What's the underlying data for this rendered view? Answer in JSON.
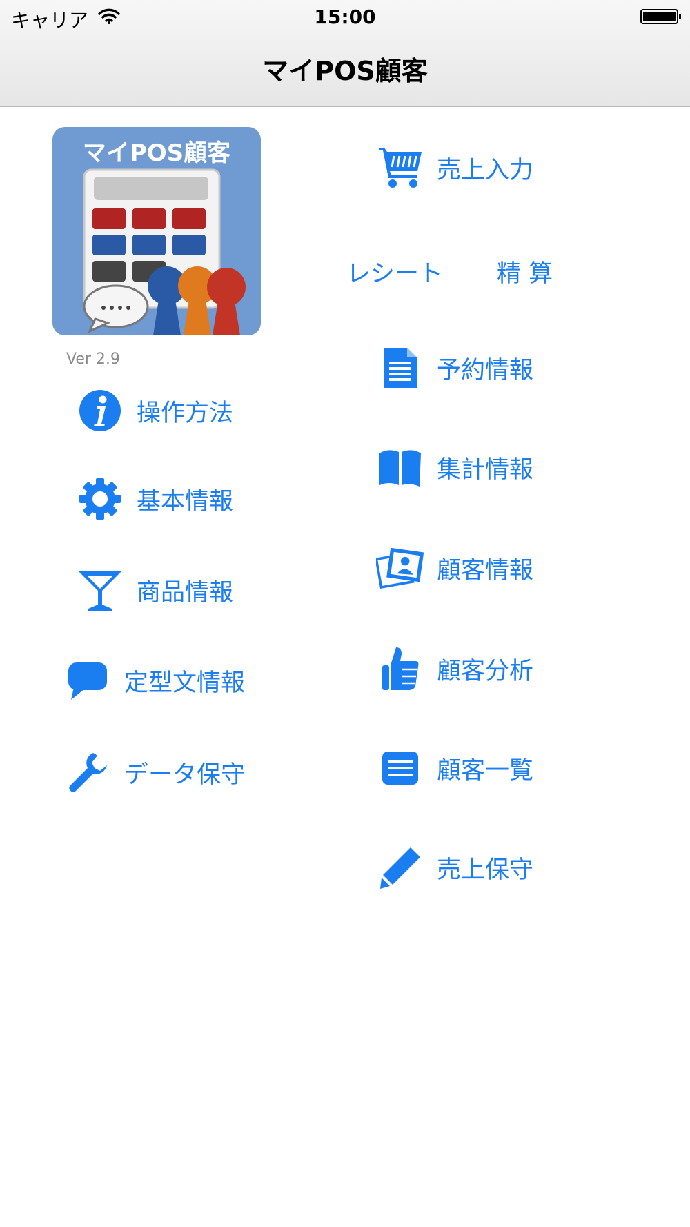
{
  "status_bar": {
    "carrier": "キャリア",
    "time": "15:00"
  },
  "nav": {
    "title": "マイPOS顧客"
  },
  "logo": {
    "text": "マイPOS顧客"
  },
  "version": "Ver 2.9",
  "left_menu": [
    {
      "label": "操作方法",
      "icon": "info-icon"
    },
    {
      "label": "基本情報",
      "icon": "gear-icon"
    },
    {
      "label": "商品情報",
      "icon": "cocktail-glass-icon"
    },
    {
      "label": "定型文情報",
      "icon": "speech-bubble-icon"
    },
    {
      "label": "データ保守",
      "icon": "wrench-icon"
    }
  ],
  "right_menu": [
    {
      "label": "売上入力",
      "icon": "shopping-cart-icon"
    },
    {
      "label": "予約情報",
      "icon": "document-icon"
    },
    {
      "label": "集計情報",
      "icon": "book-icon"
    },
    {
      "label": "顧客情報",
      "icon": "photo-person-icon"
    },
    {
      "label": "顧客分析",
      "icon": "thumbs-up-icon"
    },
    {
      "label": "顧客一覧",
      "icon": "list-icon"
    },
    {
      "label": "売上保守",
      "icon": "pencil-icon"
    }
  ],
  "receipt_label": "レシート",
  "settlement_label": "精 算",
  "colors": {
    "accent": "#1a7ef0",
    "logo_bg": "#6f9ad2"
  }
}
